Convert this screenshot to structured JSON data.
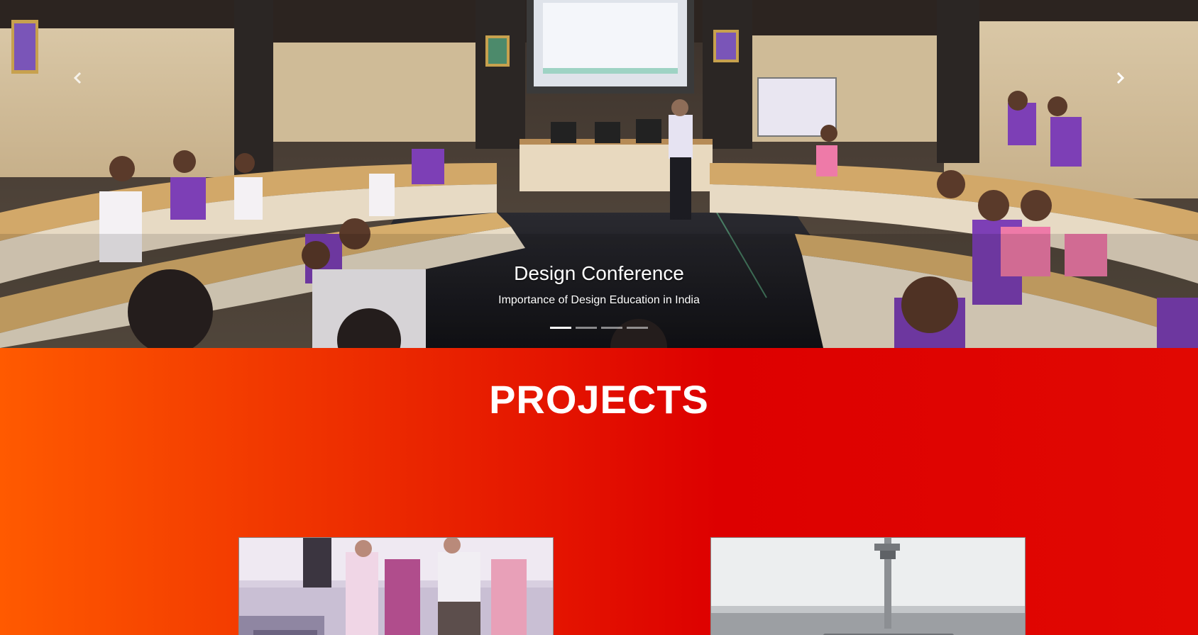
{
  "carousel": {
    "slide": {
      "title": "Design Conference",
      "subtitle": "Importance of Design Education in India"
    },
    "indicator_count": 4,
    "active_indicator": 0,
    "prev_icon": "chevron-left-icon",
    "next_icon": "chevron-right-icon"
  },
  "projects": {
    "heading": "PROJECTS",
    "gradient_colors": [
      "#ff5a00",
      "#ea2500",
      "#dd0000"
    ]
  }
}
